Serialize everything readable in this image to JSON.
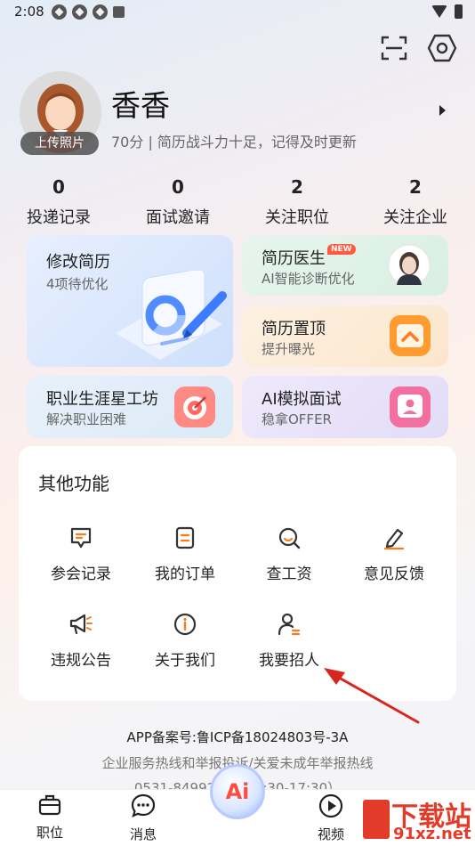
{
  "status_bar": {
    "time": "2:08"
  },
  "profile": {
    "upload_label": "上传照片",
    "name": "香香",
    "description": "70分 | 简历战斗力十足，记得及时更新"
  },
  "stats": [
    {
      "value": "0",
      "label": "投递记录"
    },
    {
      "value": "0",
      "label": "面试邀请"
    },
    {
      "value": "2",
      "label": "关注职位"
    },
    {
      "value": "2",
      "label": "关注企业"
    }
  ],
  "cards": {
    "edit_resume": {
      "title": "修改简历",
      "subtitle": "4项待优化"
    },
    "resume_doctor": {
      "title": "简历医生",
      "badge": "NEW",
      "subtitle": "AI智能诊断优化"
    },
    "resume_top": {
      "title": "简历置顶",
      "subtitle": "提升曝光"
    },
    "career_workshop": {
      "title": "职业生涯星工坊",
      "subtitle": "解决职业困难"
    },
    "ai_interview": {
      "title": "AI模拟面试",
      "subtitle": "稳拿OFFER"
    }
  },
  "other_functions": {
    "title": "其他功能",
    "items": [
      {
        "label": "参会记录",
        "icon": "chat-record-icon"
      },
      {
        "label": "我的订单",
        "icon": "order-icon"
      },
      {
        "label": "查工资",
        "icon": "salary-search-icon"
      },
      {
        "label": "意见反馈",
        "icon": "feedback-pen-icon"
      },
      {
        "label": "违规公告",
        "icon": "megaphone-icon"
      },
      {
        "label": "关于我们",
        "icon": "info-icon"
      },
      {
        "label": "我要招人",
        "icon": "recruit-icon"
      }
    ]
  },
  "footer": {
    "icp": "APP备案号:鲁ICP备18024803号-3A",
    "hotline": "企业服务热线和举报投诉/关爱未成年举报热线",
    "phone": "0531-84992570（8:30-17:30）"
  },
  "bottom_nav": {
    "items": [
      {
        "label": "职位",
        "icon": "briefcase-icon"
      },
      {
        "label": "消息",
        "icon": "message-icon"
      },
      {
        "label": "Ai",
        "icon": "ai-icon"
      },
      {
        "label": "视频",
        "icon": "video-icon"
      }
    ]
  },
  "watermark": {
    "line1": "下载站",
    "line2": "91xz.net"
  },
  "colors": {
    "accent": "#ff7a1a",
    "brand_red": "#e23b2a"
  }
}
